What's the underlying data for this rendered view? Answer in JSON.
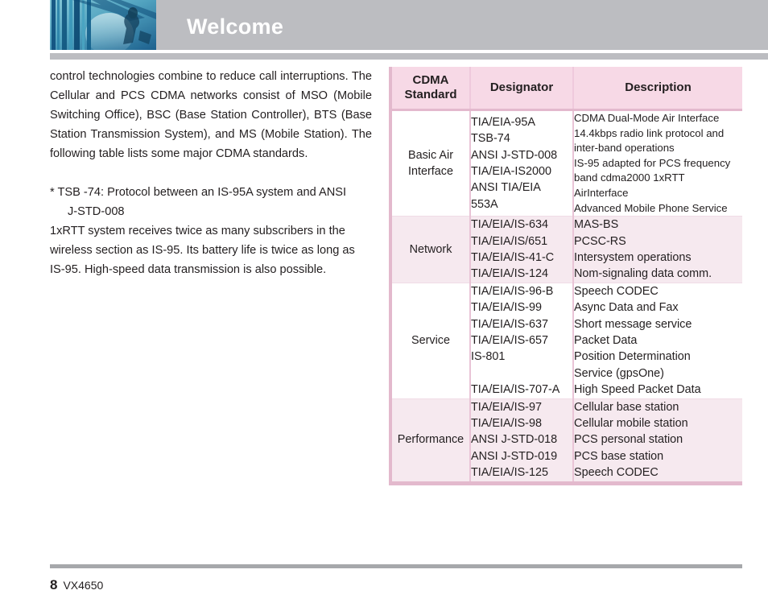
{
  "header": {
    "title": "Welcome",
    "band_color": "#bcbdc1",
    "title_color": "#ffffff",
    "photo_alt": "header-photo-blue-architecture"
  },
  "left_column": {
    "paragraph_1": "control technologies combine to reduce call interruptions. The Cellular and PCS CDMA networks consist of MSO (Mobile Switching Office), BSC (Base Station Controller), BTS (Base Station Transmission System), and MS (Mobile Station). The following table lists some major CDMA standards.",
    "note_marker": "*",
    "note_line_1": "TSB -74: Protocol between an IS-95A system and ANSI",
    "note_line_2": "J-STD-008",
    "paragraph_2": "1xRTT system receives twice as many subscribers in the wireless section as IS-95. Its battery life is twice as long as IS-95. High-speed data transmission is also possible."
  },
  "table": {
    "accent_color": "#e3b9cd",
    "header_bg": "#f7d9e6",
    "shaded_row_bg": "#f6e9ef",
    "columns": [
      {
        "label_line_1": "CDMA",
        "label_line_2": "Standard"
      },
      {
        "label_line_1": "Designator",
        "label_line_2": ""
      },
      {
        "label_line_1": "Description",
        "label_line_2": ""
      }
    ],
    "rows": [
      {
        "standard": "Basic Air Interface",
        "standard_line_1": "Basic Air",
        "standard_line_2": "Interface",
        "designator": [
          "TIA/EIA-95A",
          "TSB-74",
          "ANSI J-STD-008",
          "TIA/EIA-IS2000",
          "ANSI TIA/EIA",
          "553A"
        ],
        "description": [
          "CDMA Dual-Mode Air Interface",
          "14.4kbps radio link protocol and",
          "inter-band operations",
          "IS-95 adapted for PCS frequency",
          "band cdma2000 1xRTT",
          "AirInterface",
          "Advanced Mobile Phone Service"
        ],
        "shaded": false,
        "description_small": true
      },
      {
        "standard": "Network",
        "standard_line_1": "Network",
        "standard_line_2": "",
        "designator": [
          "TIA/EIA/IS-634",
          "TIA/EIA/IS/651",
          "TIA/EIA/IS-41-C",
          "TIA/EIA/IS-124"
        ],
        "description": [
          "MAS-BS",
          "PCSC-RS",
          "Intersystem operations",
          "Nom-signaling data comm."
        ],
        "shaded": true,
        "description_small": false
      },
      {
        "standard": "Service",
        "standard_line_1": "Service",
        "standard_line_2": "",
        "designator": [
          "TIA/EIA/IS-96-B",
          "TIA/EIA/IS-99",
          "TIA/EIA/IS-637",
          "TIA/EIA/IS-657",
          "IS-801",
          "",
          "TIA/EIA/IS-707-A"
        ],
        "description": [
          "Speech CODEC",
          "Async Data and Fax",
          "Short message service",
          "Packet Data",
          "Position Determination",
          "Service (gpsOne)",
          "High Speed Packet Data"
        ],
        "shaded": false,
        "description_small": false
      },
      {
        "standard": "Performance",
        "standard_line_1": "Performance",
        "standard_line_2": "",
        "designator": [
          "TIA/EIA/IS-97",
          "TIA/EIA/IS-98",
          "ANSI J-STD-018",
          "ANSI J-STD-019",
          "TIA/EIA/IS-125"
        ],
        "description": [
          "Cellular base station",
          "Cellular mobile station",
          "PCS personal station",
          "PCS base station",
          "Speech CODEC"
        ],
        "shaded": true,
        "description_small": false
      }
    ]
  },
  "footer": {
    "page_number": "8",
    "model": "VX4650",
    "rule_color": "#a6a8ab"
  }
}
